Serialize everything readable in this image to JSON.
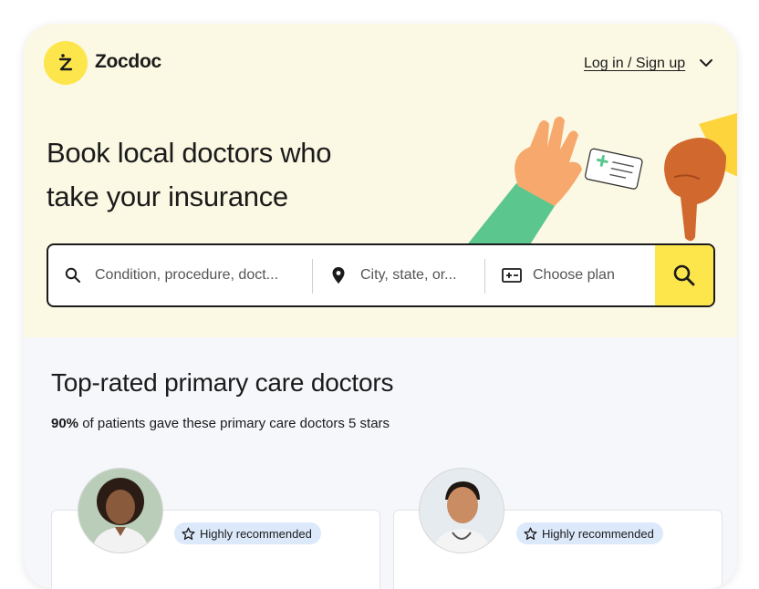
{
  "brand": {
    "name": "Zocdoc"
  },
  "header": {
    "login_label": "Log in / Sign up"
  },
  "hero": {
    "headline_line1": "Book local doctors who",
    "headline_line2": "take your insurance"
  },
  "search": {
    "condition_placeholder": "Condition, procedure, doct...",
    "location_placeholder": "City, state, or...",
    "plan_placeholder": "Choose plan"
  },
  "section": {
    "title": "Top-rated primary care doctors",
    "subtitle_strong": "90%",
    "subtitle_rest": " of patients gave these primary care doctors 5 stars"
  },
  "doctors": [
    {
      "badge": "Highly recommended"
    },
    {
      "badge": "Highly recommended"
    }
  ],
  "colors": {
    "brand_yellow": "#fde64b",
    "hero_bg": "#fbf8e3",
    "badge_bg": "#dce9fb",
    "page_bg": "#f5f7fa"
  },
  "icons": [
    "zocdoc-logo-icon",
    "chevron-down-icon",
    "search-icon",
    "location-pin-icon",
    "insurance-card-icon",
    "star-outline-icon"
  ]
}
